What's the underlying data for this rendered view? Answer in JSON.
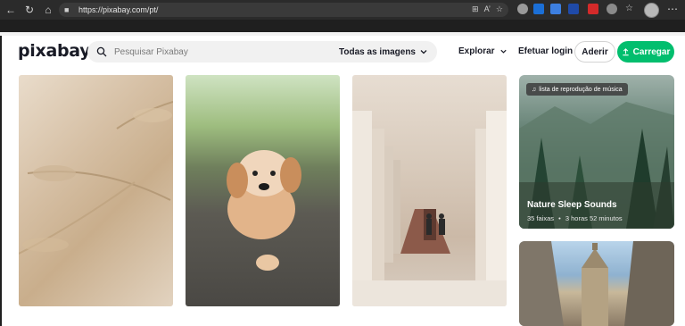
{
  "browser": {
    "url": "https://pixabay.com/pt/",
    "url_tools": [
      "⊞",
      "A’",
      "☆"
    ]
  },
  "header": {
    "logo": "pixabay",
    "search_placeholder": "Pesquisar Pixabay",
    "search_filter": "Todas as imagens",
    "explore": "Explorar",
    "login": "Efetuar login",
    "join": "Aderir",
    "upload": "Carregar"
  },
  "playlist_card": {
    "badge": "lista de reprodução de música",
    "title": "Nature Sleep Sounds",
    "tracks": "35 faixas",
    "separator": "•",
    "duration": "3 horas 52 minutos"
  },
  "colors": {
    "accent_green": "#02be6e",
    "text_dark": "#191b26"
  },
  "icons": {
    "back": "back-arrow-icon",
    "reload": "reload-icon",
    "home": "home-icon",
    "lock": "lock-icon",
    "search": "search-icon",
    "chevron": "chevron-down-icon",
    "upload": "upload-icon",
    "music": "music-note-icon"
  }
}
